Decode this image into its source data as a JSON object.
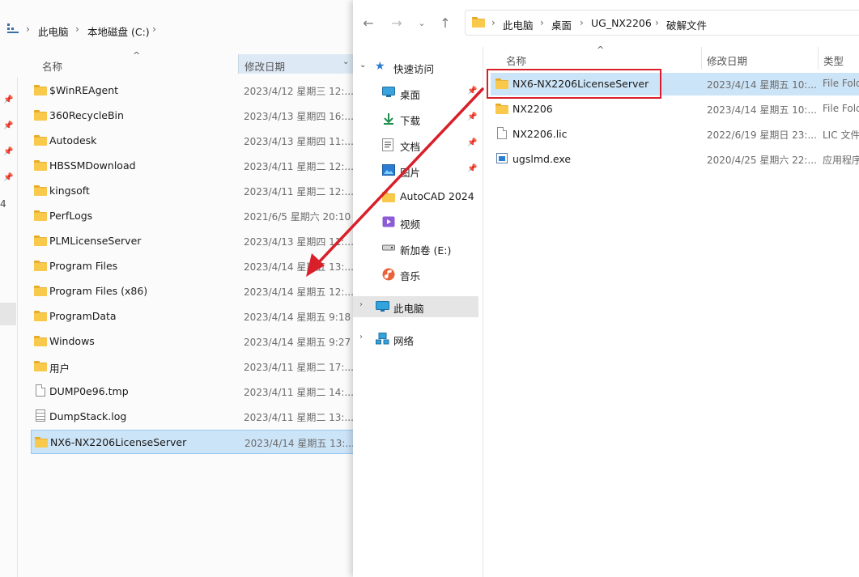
{
  "left_window": {
    "breadcrumb": [
      "此电脑",
      "本地磁盘 (C:)"
    ],
    "columns": {
      "name": "名称",
      "date": "修改日期"
    },
    "side_text": "4",
    "rows": [
      {
        "name": "$WinREAgent",
        "date": "2023/4/12 星期三 12:...",
        "icon": "folder-icon"
      },
      {
        "name": "360RecycleBin",
        "date": "2023/4/13 星期四 16:...",
        "icon": "folder-icon"
      },
      {
        "name": "Autodesk",
        "date": "2023/4/13 星期四 11:...",
        "icon": "folder-icon"
      },
      {
        "name": "HBSSMDownload",
        "date": "2023/4/11 星期二 12:...",
        "icon": "folder-icon"
      },
      {
        "name": "kingsoft",
        "date": "2023/4/11 星期二 12:...",
        "icon": "folder-icon"
      },
      {
        "name": "PerfLogs",
        "date": "2021/6/5 星期六 20:10",
        "icon": "folder-icon"
      },
      {
        "name": "PLMLicenseServer",
        "date": "2023/4/13 星期四 11:...",
        "icon": "folder-icon"
      },
      {
        "name": "Program Files",
        "date": "2023/4/14 星期五 13:...",
        "icon": "folder-icon"
      },
      {
        "name": "Program Files (x86)",
        "date": "2023/4/14 星期五 12:...",
        "icon": "folder-icon"
      },
      {
        "name": "ProgramData",
        "date": "2023/4/14 星期五 9:18",
        "icon": "folder-icon"
      },
      {
        "name": "Windows",
        "date": "2023/4/14 星期五 9:27",
        "icon": "folder-icon"
      },
      {
        "name": "用户",
        "date": "2023/4/11 星期二 17:...",
        "icon": "folder-icon"
      },
      {
        "name": "DUMP0e96.tmp",
        "date": "2023/4/11 星期二 14:...",
        "icon": "file-icon"
      },
      {
        "name": "DumpStack.log",
        "date": "2023/4/11 星期二 13:...",
        "icon": "text-file-icon"
      },
      {
        "name": "NX6-NX2206LicenseServer",
        "date": "2023/4/14 星期五 13:...",
        "icon": "folder-icon",
        "selected": true
      }
    ]
  },
  "right_window": {
    "breadcrumb": [
      "此电脑",
      "桌面",
      "UG_NX2206",
      "破解文件"
    ],
    "nav_pane": {
      "quick_access": "快速访问",
      "items": [
        {
          "label": "桌面",
          "icon": "desktop-icon",
          "pinned": true
        },
        {
          "label": "下载",
          "icon": "download-icon",
          "pinned": true
        },
        {
          "label": "文档",
          "icon": "documents-icon",
          "pinned": true
        },
        {
          "label": "图片",
          "icon": "pictures-icon",
          "pinned": true
        },
        {
          "label": "AutoCAD 2024",
          "icon": "folder-icon",
          "pinned": false
        },
        {
          "label": "视频",
          "icon": "videos-icon",
          "pinned": false
        },
        {
          "label": "新加卷 (E:)",
          "icon": "drive-icon",
          "pinned": false
        },
        {
          "label": "音乐",
          "icon": "music-icon",
          "pinned": false
        }
      ],
      "this_pc": "此电脑",
      "network": "网络"
    },
    "columns": {
      "name": "名称",
      "date": "修改日期",
      "type": "类型"
    },
    "rows": [
      {
        "name": "NX6-NX2206LicenseServer",
        "date": "2023/4/14 星期五 10:...",
        "type": "File Folder",
        "icon": "folder-icon",
        "selected": true
      },
      {
        "name": "NX2206",
        "date": "2023/4/14 星期五 10:...",
        "type": "File Folder",
        "icon": "folder-icon"
      },
      {
        "name": "NX2206.lic",
        "date": "2022/6/19 星期日 23:...",
        "type": "LIC 文件",
        "icon": "file-icon"
      },
      {
        "name": "ugslmd.exe",
        "date": "2020/4/25 星期六 22:...",
        "type": "应用程序",
        "icon": "exe-icon"
      }
    ]
  },
  "annotation": {
    "arrow_color": "#d9202a",
    "box_color": "#d9202a"
  }
}
